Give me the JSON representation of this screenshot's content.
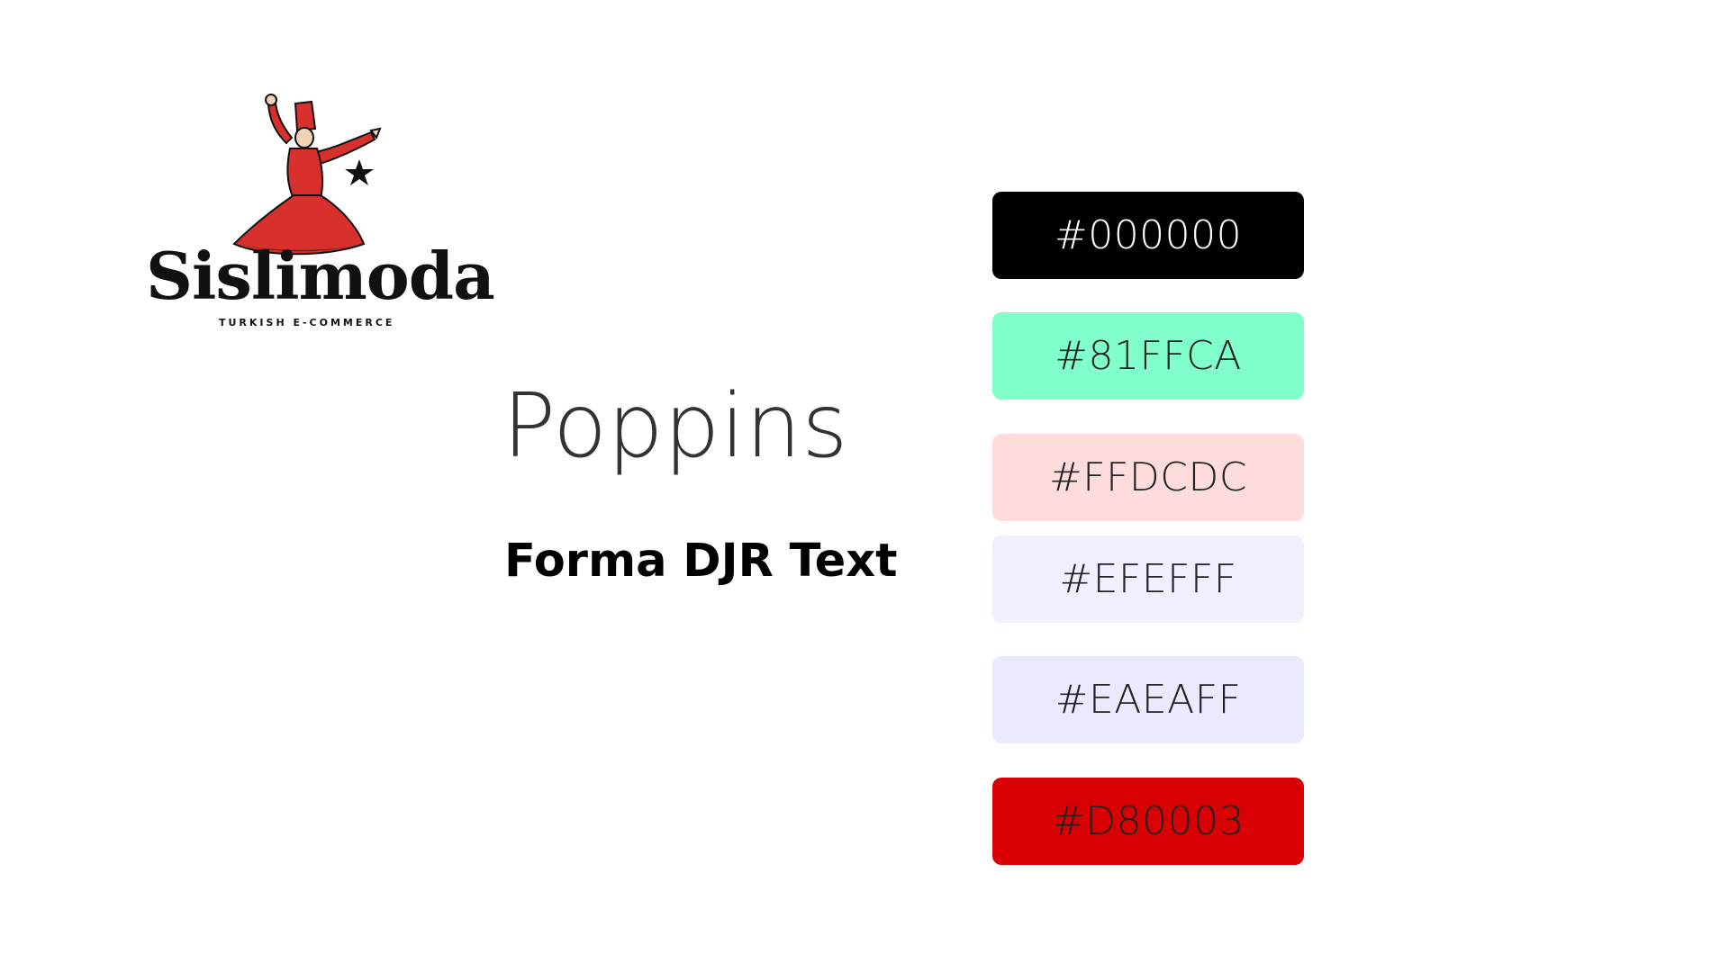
{
  "logo": {
    "name": "Sislimoda",
    "tagline": "TURKISH E-COMMERCE",
    "icon": "whirling-dervish-icon",
    "colors": {
      "robe": "#D8302C",
      "ink": "#111111"
    }
  },
  "fonts": {
    "display": "Poppins",
    "text": "Forma DJR Text"
  },
  "swatches": [
    {
      "label": "#000000",
      "color": "#000000",
      "text_color": "#FFFFFF"
    },
    {
      "label": "#81FFCA",
      "color": "#81FFCA",
      "text_color": "#222222"
    },
    {
      "label": "#FFDCDC",
      "color": "#FFDCDC",
      "text_color": "#222222"
    },
    {
      "label": "#EFEFFF",
      "color": "#EFEFFF",
      "text_color": "#222222"
    },
    {
      "label": "#EAEAFF",
      "color": "#EAEAFF",
      "text_color": "#222222"
    },
    {
      "label": "#D80003",
      "color": "#D80003",
      "text_color": "#222222"
    }
  ]
}
